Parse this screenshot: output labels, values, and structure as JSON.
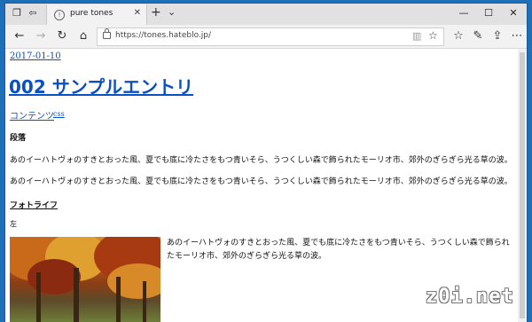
{
  "browser": {
    "tab_title": "pure tones",
    "tab_close": "✕",
    "new_tab": "+",
    "tab_list": "⌄",
    "minimize": "—",
    "maximize": "☐",
    "close": "✕",
    "url": "https://tones.hateblo.jp/"
  },
  "icons": {
    "tab-preview": "tab-preview-icon",
    "set-aside": "set-aside-tabs-icon",
    "back": "back-arrow-icon",
    "forward": "forward-arrow-icon",
    "refresh": "refresh-icon",
    "home": "home-icon",
    "reading-view": "reading-view-icon",
    "favorite": "star-icon",
    "hub": "hub-icon",
    "notes": "pen-icon",
    "share": "share-icon",
    "more": "more-icon"
  },
  "page": {
    "date": "2017-01-10",
    "title": "002 サンプルエントリ",
    "categories": [
      "コンテンツ",
      "css"
    ],
    "heading_paragraph": "段落",
    "paragraphs": [
      "あのイーハトヴォのすきとおった風、夏でも底に冷たさをもつ青いそら、うつくしい森で飾られたモーリオ市、郊外のぎらぎら光る草の波。",
      "あのイーハトヴォのすきとおった風、夏でも底に冷たさをもつ青いそら、うつくしい森で飾られたモーリオ市、郊外のぎらぎら光る草の波。"
    ],
    "heading_photo": "フォトライフ",
    "label_left": "左",
    "photo_caption": "あのイーハトヴォのすきとおった風、夏でも底に冷たさをもつ青いそら、うつくしい森で飾られたモーリオ市、郊外のぎらぎら光る草の波。"
  },
  "watermark": "z0i.net",
  "colors": {
    "link": "#0b4fc4",
    "desktop": "#1f6fb8"
  }
}
